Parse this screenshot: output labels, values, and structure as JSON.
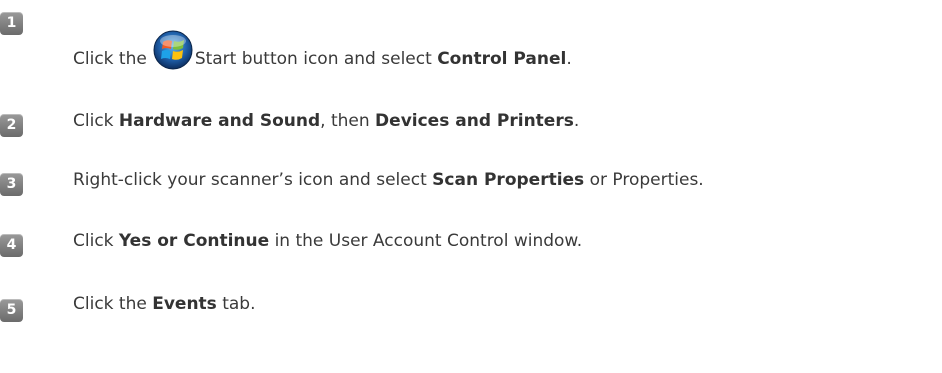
{
  "steps": [
    {
      "number": "1",
      "parts": [
        "Click the",
        "Start button icon and select",
        "Control Panel",
        "."
      ]
    },
    {
      "number": "2",
      "parts": [
        "Click",
        "Hardware and Sound",
        ", then",
        "Devices and Printers",
        "."
      ]
    },
    {
      "number": "3",
      "parts": [
        "Right-click your scanner’s icon and select",
        "Scan Properties",
        "or Properties."
      ]
    },
    {
      "number": "4",
      "parts": [
        "Click",
        "Yes or Continue",
        "in the User Account Control window."
      ]
    },
    {
      "number": "5",
      "parts": [
        "Click the",
        "Events",
        "tab."
      ]
    }
  ],
  "icons": {
    "start_button": "windows-start-orb-icon"
  },
  "colors": {
    "badge": "#7f7f7f",
    "text": "#3a3a3a"
  }
}
